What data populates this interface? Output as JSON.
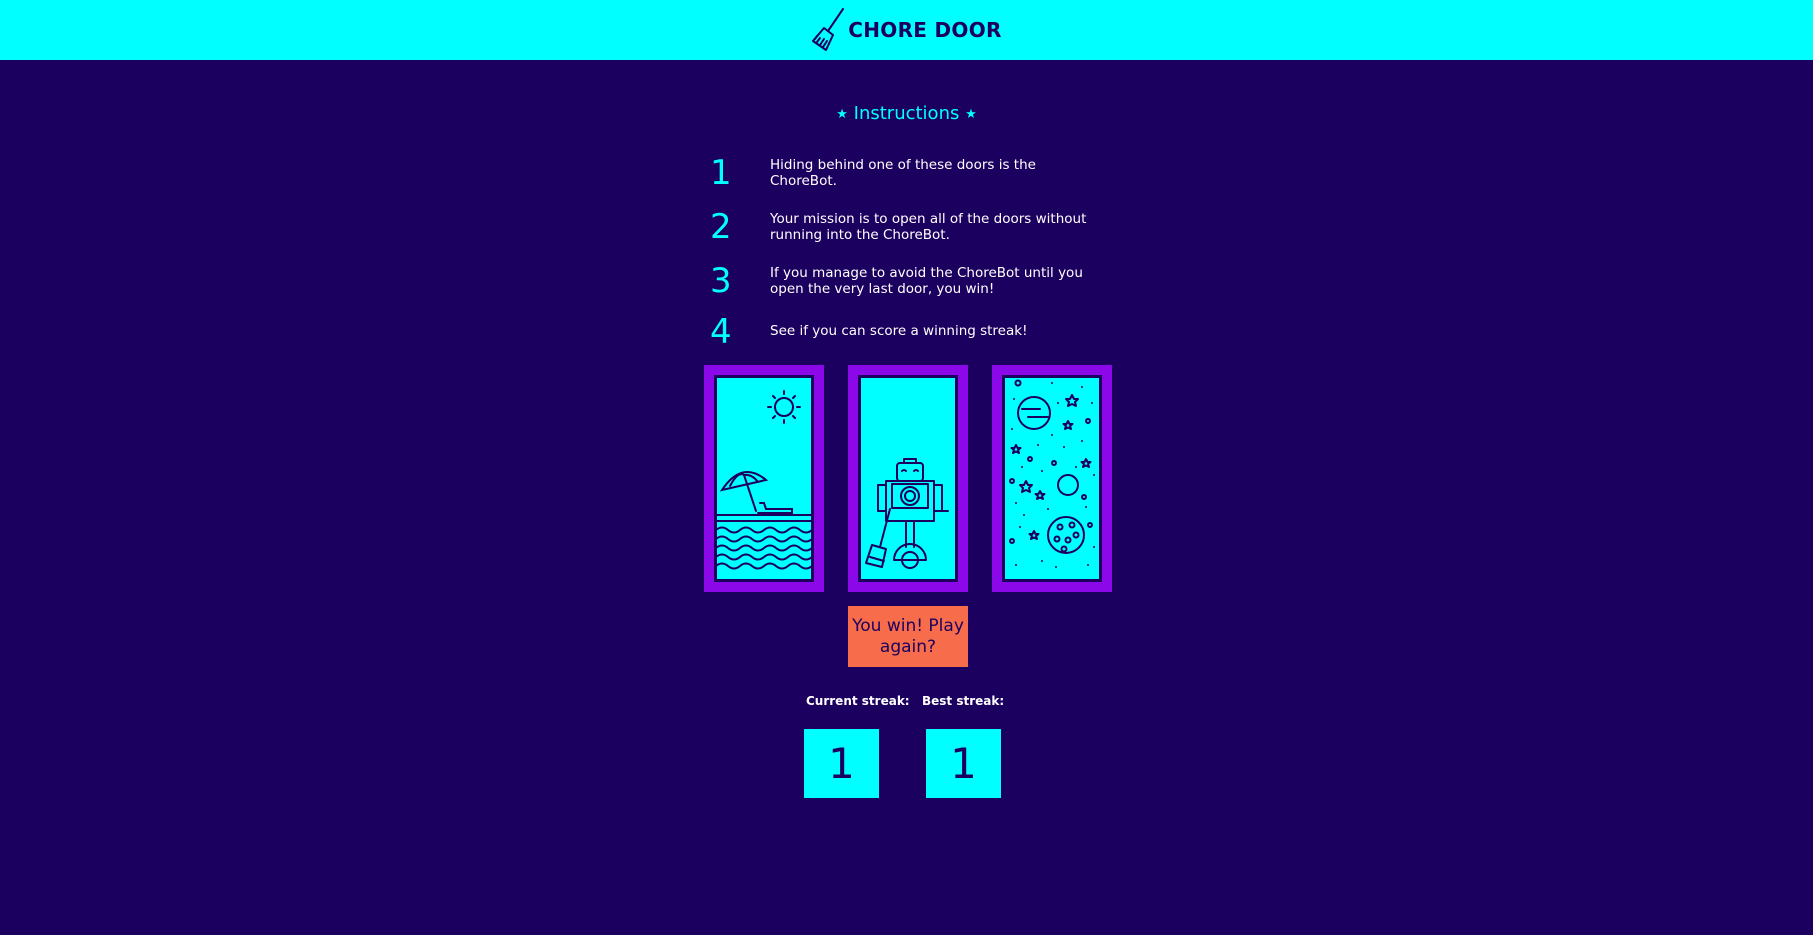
{
  "header": {
    "title": "CHORE DOOR",
    "logo_icon": "broom-icon"
  },
  "instructions": {
    "title": "Instructions",
    "star": "★",
    "steps": [
      {
        "num": "1",
        "text": "Hiding behind one of these doors is the ChoreBot."
      },
      {
        "num": "2",
        "text": "Your mission is to open all of the doors without running into the ChoreBot."
      },
      {
        "num": "3",
        "text": "If you manage to avoid the ChoreBot until you open the very last door, you win!"
      },
      {
        "num": "4",
        "text": "See if you can score a winning streak!"
      }
    ]
  },
  "doors": [
    {
      "scene": "beach-scene-icon"
    },
    {
      "scene": "chorebot-robot-icon"
    },
    {
      "scene": "space-scene-icon"
    }
  ],
  "play_button": {
    "label": "You win! Play again?"
  },
  "score": {
    "current_label": "Current streak:",
    "current_value": "1",
    "best_label": "Best streak:",
    "best_value": "1"
  },
  "colors": {
    "background": "#1c005f",
    "accent": "#00ffff",
    "door_frame": "#8b08e8",
    "button": "#f76c4a",
    "text": "#ffffff"
  }
}
